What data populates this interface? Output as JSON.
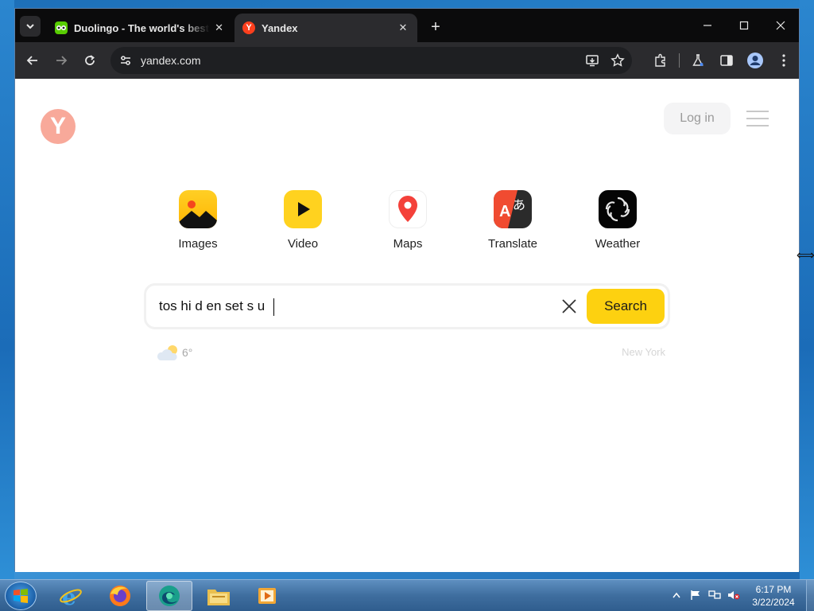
{
  "browser": {
    "tabs": [
      {
        "title": "Duolingo - The world's best way to learn a language",
        "active": false,
        "favicon": "duolingo-owl-icon"
      },
      {
        "title": "Yandex",
        "active": true,
        "favicon": "yandex-y-icon"
      }
    ],
    "url": "yandex.com"
  },
  "page": {
    "logo_letter": "Y",
    "login_label": "Log in",
    "services": [
      {
        "label": "Images",
        "icon": "images-icon"
      },
      {
        "label": "Video",
        "icon": "video-play-icon"
      },
      {
        "label": "Maps",
        "icon": "map-pin-icon"
      },
      {
        "label": "Translate",
        "icon": "translate-icon"
      },
      {
        "label": "Weather",
        "icon": "weather-icon"
      }
    ],
    "search": {
      "value": "tos hi d en set s u",
      "button_label": "Search"
    },
    "weather": {
      "temperature": "6°",
      "city": "New York"
    }
  },
  "taskbar": {
    "apps": [
      "internet-explorer-icon",
      "firefox-icon",
      "edge-icon",
      "file-explorer-icon",
      "media-player-icon"
    ],
    "time": "6:17 PM",
    "date": "3/22/2024"
  },
  "colors": {
    "search_button": "#fdd110",
    "logo": "#f8a99a",
    "tab_bar": "#0b0b0c",
    "toolbar": "#2b2b2e"
  }
}
